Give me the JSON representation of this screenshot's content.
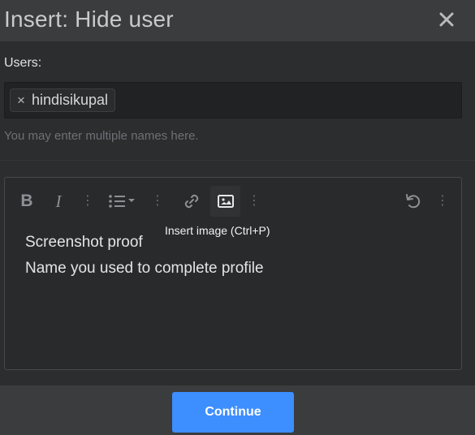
{
  "dialog": {
    "title": "Insert: Hide user"
  },
  "users": {
    "label": "Users:",
    "tokens": [
      {
        "name": "hindisikupal",
        "remove_glyph": "×"
      }
    ],
    "hint": "You may enter multiple names here."
  },
  "editor": {
    "toolbar": {
      "bold_label": "B",
      "italic_label": "I",
      "more_glyph": "⋮",
      "icons": [
        "bold-icon",
        "italic-icon",
        "list-icon",
        "link-icon",
        "image-icon",
        "undo-icon"
      ]
    },
    "tooltip": "Insert image (Ctrl+P)",
    "lines": [
      "Screenshot proof",
      "Name you used to complete profile"
    ]
  },
  "footer": {
    "continue_label": "Continue"
  },
  "colors": {
    "accent": "#3d8eff",
    "background": "#2b2d2f",
    "header": "#3a3c3e"
  }
}
